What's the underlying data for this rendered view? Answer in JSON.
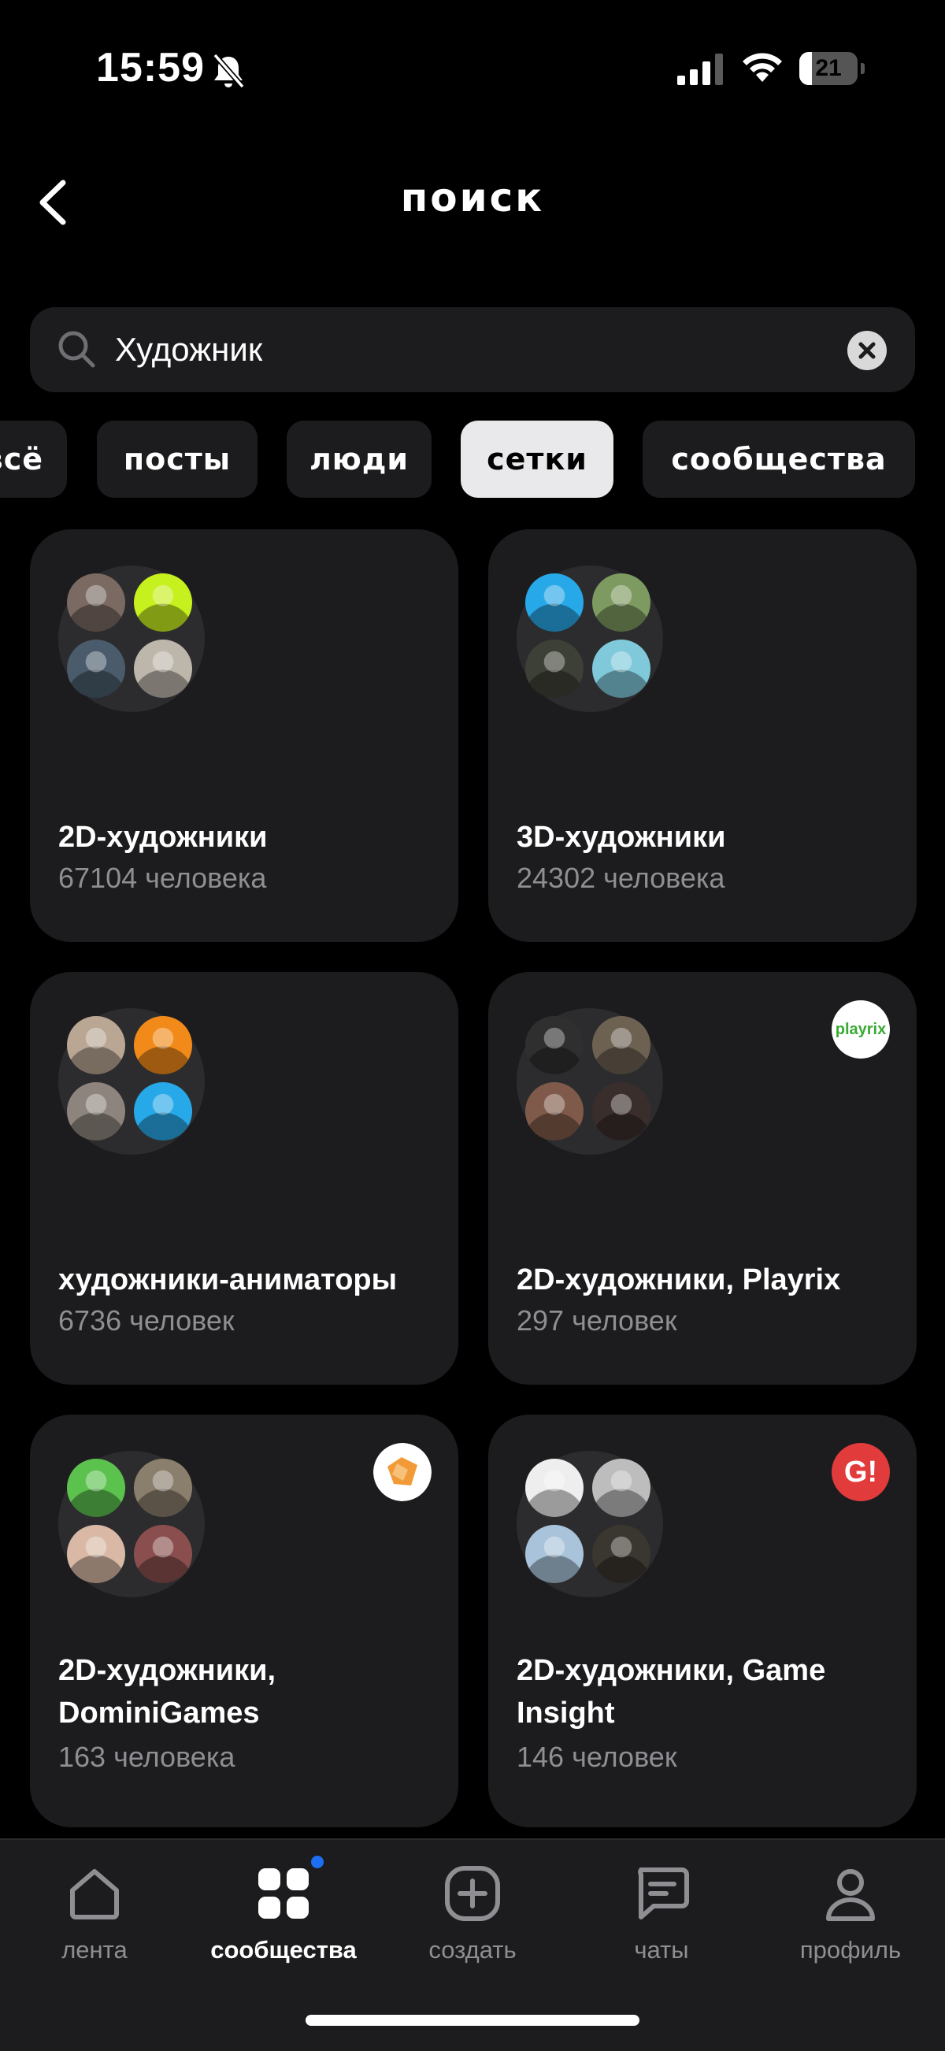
{
  "status_bar": {
    "time": "15:59",
    "battery": "21",
    "battery_level": 0.21
  },
  "header": {
    "title": "поиск"
  },
  "search": {
    "value": "Художник",
    "placeholder": ""
  },
  "filters": [
    {
      "label": "всё",
      "active": false
    },
    {
      "label": "посты",
      "active": false
    },
    {
      "label": "люди",
      "active": false
    },
    {
      "label": "сетки",
      "active": true
    },
    {
      "label": "сообщества",
      "active": false
    }
  ],
  "cards": [
    {
      "title": "2D-художники",
      "count": "67104 человека",
      "avatars": [
        "#7a6a62",
        "#c6f01e",
        "#4a5c6c",
        "#bdb6aa"
      ],
      "badge": null
    },
    {
      "title": "3D-художники",
      "count": "24302 человека",
      "avatars": [
        "#27a8e8",
        "#7d9a60",
        "#3d4036",
        "#7fc9da"
      ],
      "badge": null
    },
    {
      "title": "художники-аниматоры",
      "count": "6736 человек",
      "avatars": [
        "#b9a693",
        "#f28a1a",
        "#8d857d",
        "#27a8e8"
      ],
      "badge": null
    },
    {
      "title": "2D-художники, Playrix",
      "count": "297 человек",
      "avatars": [
        "#2f2f2f",
        "#6d6152",
        "#7f5a4a",
        "#3a2e2c"
      ],
      "badge": {
        "text": "playrix",
        "bg": "#ffffff",
        "color": "#3aaa35"
      }
    },
    {
      "title": "2D-художники, DominiGames",
      "count": "163 человека",
      "avatars": [
        "#5cc24e",
        "#8a7e6c",
        "#d9b8a6",
        "#8a4e4e"
      ],
      "badge": {
        "text": "",
        "bg": "#ffffff",
        "color": "#f29a38"
      }
    },
    {
      "title": "2D-художники, Game Insight",
      "count": "146 человек",
      "avatars": [
        "#eeeeee",
        "#bdbdbd",
        "#a9c3da",
        "#3a3630"
      ],
      "badge": {
        "text": "G!",
        "bg": "#e23b3b",
        "color": "#ffffff"
      }
    }
  ],
  "tabs": [
    {
      "label": "лента",
      "icon": "home-icon",
      "active": false
    },
    {
      "label": "сообщества",
      "icon": "grid-icon",
      "active": true
    },
    {
      "label": "создать",
      "icon": "plus-square-icon",
      "active": false
    },
    {
      "label": "чаты",
      "icon": "chat-icon",
      "active": false
    },
    {
      "label": "профиль",
      "icon": "profile-icon",
      "active": false
    }
  ],
  "colors": {
    "background": "#000000",
    "surface": "#1c1c1e",
    "muted_text": "#8e8e93",
    "active_chip": "#e9e9eb",
    "notification_dot": "#1c6ef2"
  }
}
